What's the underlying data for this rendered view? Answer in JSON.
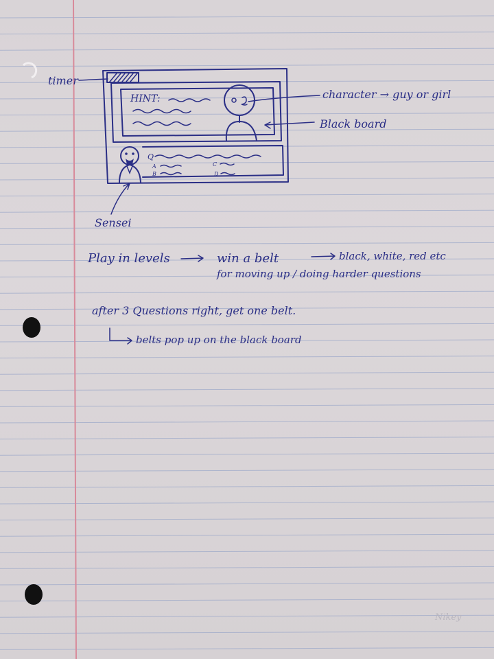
{
  "sketch": {
    "label_timer": "timer",
    "hint_label": "HINT:",
    "label_character": "character → guy or girl",
    "label_blackboard": "Black board",
    "question_letter": "Q",
    "option_a": "A",
    "option_b": "B",
    "option_c": "C",
    "option_d": "D",
    "label_sensei": "Sensei"
  },
  "notes": {
    "line1_part1": "Play in levels",
    "line1_part2": "win a belt",
    "line1_part3": "black, white, red etc",
    "line2": "for moving up / doing harder questions",
    "line3": "after 3 Questions right, get one belt.",
    "line4": "belts pop up on the black board"
  },
  "signature": "Nikey",
  "colors": {
    "ink": "#2b2f86",
    "paper": "#d9d4d7",
    "rule_line": "#9aa7c9",
    "margin_line": "#d88a9a",
    "hole": "#111111"
  }
}
